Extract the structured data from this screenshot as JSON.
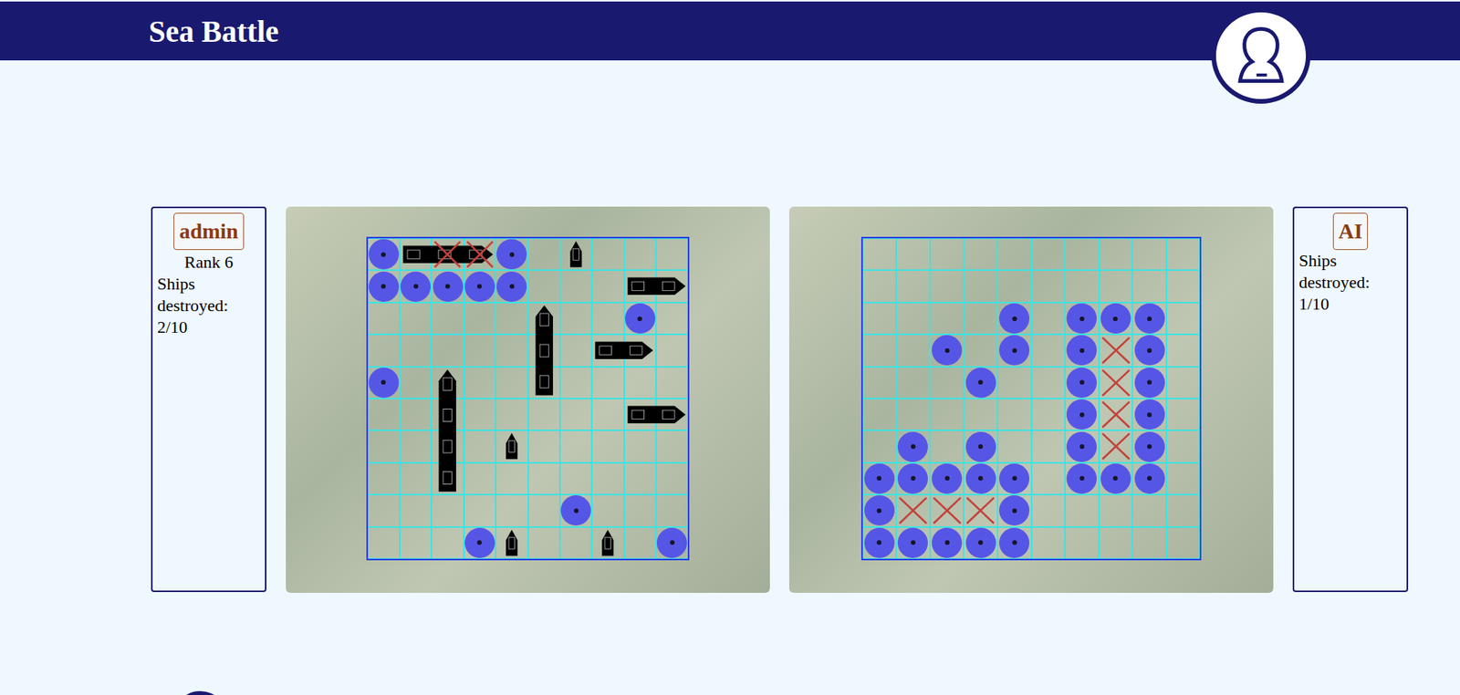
{
  "header": {
    "title": "Sea Battle"
  },
  "players": [
    {
      "name": "admin",
      "rank": "Rank 6",
      "destroyed_label": "Ships destroyed:",
      "destroyed": "2/10"
    },
    {
      "name": "AI",
      "rank": "",
      "destroyed_label": "Ships destroyed:",
      "destroyed": "1/10"
    }
  ],
  "boards": [
    {
      "owner": "admin",
      "size": 10,
      "ships": [
        {
          "row": 0,
          "col": 1,
          "length": 3,
          "vertical": false
        },
        {
          "row": 0,
          "col": 6,
          "length": 1,
          "vertical": true
        },
        {
          "row": 1,
          "col": 8,
          "length": 2,
          "vertical": false
        },
        {
          "row": 2,
          "col": 5,
          "length": 3,
          "vertical": true
        },
        {
          "row": 3,
          "col": 7,
          "length": 2,
          "vertical": false
        },
        {
          "row": 4,
          "col": 2,
          "length": 4,
          "vertical": true
        },
        {
          "row": 5,
          "col": 8,
          "length": 2,
          "vertical": false
        },
        {
          "row": 6,
          "col": 4,
          "length": 1,
          "vertical": true
        },
        {
          "row": 9,
          "col": 4,
          "length": 1,
          "vertical": true
        },
        {
          "row": 9,
          "col": 7,
          "length": 1,
          "vertical": true
        }
      ],
      "shots": [
        {
          "row": 0,
          "col": 0,
          "result": "miss"
        },
        {
          "row": 0,
          "col": 2,
          "result": "hit"
        },
        {
          "row": 0,
          "col": 3,
          "result": "hit"
        },
        {
          "row": 0,
          "col": 4,
          "result": "miss"
        },
        {
          "row": 1,
          "col": 0,
          "result": "miss"
        },
        {
          "row": 1,
          "col": 1,
          "result": "miss"
        },
        {
          "row": 1,
          "col": 2,
          "result": "miss"
        },
        {
          "row": 1,
          "col": 3,
          "result": "miss"
        },
        {
          "row": 1,
          "col": 4,
          "result": "miss"
        },
        {
          "row": 2,
          "col": 8,
          "result": "miss"
        },
        {
          "row": 4,
          "col": 0,
          "result": "miss"
        },
        {
          "row": 8,
          "col": 6,
          "result": "miss"
        },
        {
          "row": 9,
          "col": 3,
          "result": "miss"
        },
        {
          "row": 9,
          "col": 9,
          "result": "miss"
        }
      ]
    },
    {
      "owner": "AI",
      "size": 10,
      "ships": [],
      "shots": [
        {
          "row": 2,
          "col": 4,
          "result": "miss"
        },
        {
          "row": 2,
          "col": 6,
          "result": "miss"
        },
        {
          "row": 2,
          "col": 7,
          "result": "miss"
        },
        {
          "row": 2,
          "col": 8,
          "result": "miss"
        },
        {
          "row": 3,
          "col": 2,
          "result": "miss"
        },
        {
          "row": 3,
          "col": 4,
          "result": "miss"
        },
        {
          "row": 3,
          "col": 6,
          "result": "miss"
        },
        {
          "row": 3,
          "col": 7,
          "result": "hit"
        },
        {
          "row": 3,
          "col": 8,
          "result": "miss"
        },
        {
          "row": 4,
          "col": 3,
          "result": "miss"
        },
        {
          "row": 4,
          "col": 6,
          "result": "miss"
        },
        {
          "row": 4,
          "col": 7,
          "result": "hit"
        },
        {
          "row": 4,
          "col": 8,
          "result": "miss"
        },
        {
          "row": 5,
          "col": 6,
          "result": "miss"
        },
        {
          "row": 5,
          "col": 7,
          "result": "hit"
        },
        {
          "row": 5,
          "col": 8,
          "result": "miss"
        },
        {
          "row": 6,
          "col": 1,
          "result": "miss"
        },
        {
          "row": 6,
          "col": 3,
          "result": "miss"
        },
        {
          "row": 6,
          "col": 6,
          "result": "miss"
        },
        {
          "row": 6,
          "col": 7,
          "result": "hit"
        },
        {
          "row": 6,
          "col": 8,
          "result": "miss"
        },
        {
          "row": 7,
          "col": 0,
          "result": "miss"
        },
        {
          "row": 7,
          "col": 1,
          "result": "miss"
        },
        {
          "row": 7,
          "col": 2,
          "result": "miss"
        },
        {
          "row": 7,
          "col": 3,
          "result": "miss"
        },
        {
          "row": 7,
          "col": 4,
          "result": "miss"
        },
        {
          "row": 7,
          "col": 6,
          "result": "miss"
        },
        {
          "row": 7,
          "col": 7,
          "result": "miss"
        },
        {
          "row": 7,
          "col": 8,
          "result": "miss"
        },
        {
          "row": 8,
          "col": 0,
          "result": "miss"
        },
        {
          "row": 8,
          "col": 1,
          "result": "hit"
        },
        {
          "row": 8,
          "col": 2,
          "result": "hit"
        },
        {
          "row": 8,
          "col": 3,
          "result": "hit"
        },
        {
          "row": 8,
          "col": 4,
          "result": "miss"
        },
        {
          "row": 9,
          "col": 0,
          "result": "miss"
        },
        {
          "row": 9,
          "col": 1,
          "result": "miss"
        },
        {
          "row": 9,
          "col": 2,
          "result": "miss"
        },
        {
          "row": 9,
          "col": 3,
          "result": "miss"
        },
        {
          "row": 9,
          "col": 4,
          "result": "miss"
        }
      ]
    }
  ]
}
